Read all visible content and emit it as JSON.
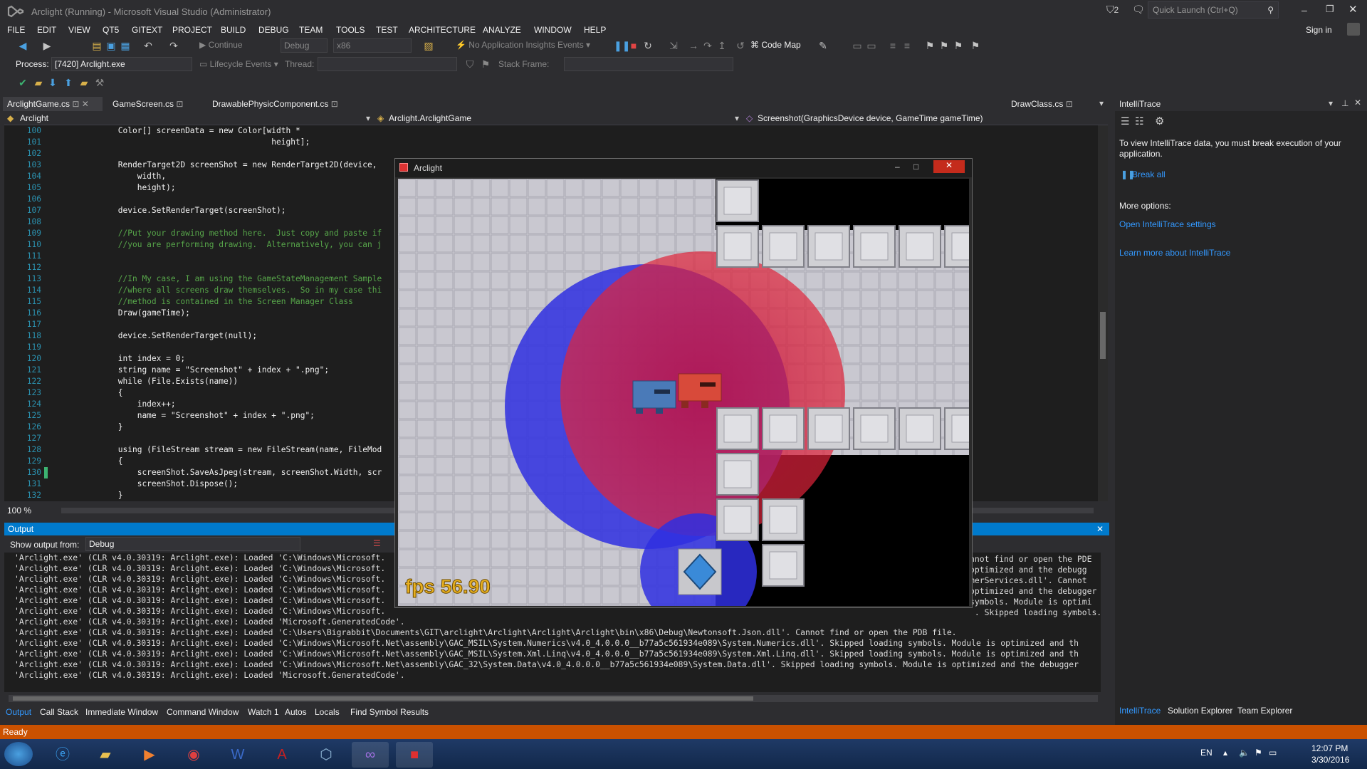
{
  "window": {
    "title": "Arclight (Running) - Microsoft Visual Studio (Administrator)",
    "notif_count": "2",
    "quick_launch": "Quick Launch (Ctrl+Q)",
    "sign_in": "Sign in"
  },
  "menu": [
    "FILE",
    "EDIT",
    "VIEW",
    "QT5",
    "GITEXT",
    "PROJECT",
    "BUILD",
    "DEBUG",
    "TEAM",
    "TOOLS",
    "TEST",
    "ARCHITECTURE",
    "ANALYZE",
    "WINDOW",
    "HELP"
  ],
  "toolbar": {
    "continue": "Continue",
    "config": "Debug",
    "platform": "x86",
    "insights": "No Application Insights Events",
    "codemap": "Code Map",
    "process_label": "Process:",
    "process": "[7420] Arclight.exe",
    "lifecycle": "Lifecycle Events",
    "thread": "Thread:",
    "stackframe": "Stack Frame:"
  },
  "doc_tabs": [
    "ArclightGame.cs",
    "GameScreen.cs",
    "DrawablePhysicComponent.cs",
    "DrawClass.cs"
  ],
  "nav": {
    "project": "Arclight",
    "class": "Arclight.ArclightGame",
    "member": "Screenshot(GraphicsDevice device, GameTime gameTime)"
  },
  "code": [
    {
      "n": "100",
      "t": "            Color[] screenData = new Color[width *"
    },
    {
      "n": "101",
      "t": "                                            height];"
    },
    {
      "n": "102",
      "t": ""
    },
    {
      "n": "103",
      "t": "            RenderTarget2D screenShot = new RenderTarget2D(device,"
    },
    {
      "n": "104",
      "t": "                width,"
    },
    {
      "n": "105",
      "t": "                height);"
    },
    {
      "n": "106",
      "t": ""
    },
    {
      "n": "107",
      "t": "            device.SetRenderTarget(screenShot);"
    },
    {
      "n": "108",
      "t": ""
    },
    {
      "n": "109",
      "t": "            //Put your drawing method here.  Just copy and paste if"
    },
    {
      "n": "110",
      "t": "            //you are performing drawing.  Alternatively, you can j"
    },
    {
      "n": "111",
      "t": ""
    },
    {
      "n": "112",
      "t": ""
    },
    {
      "n": "113",
      "t": "            //In My case, I am using the GameStateManagement Sample"
    },
    {
      "n": "114",
      "t": "            //where all screens draw themselves.  So in my case thi"
    },
    {
      "n": "115",
      "t": "            //method is contained in the Screen Manager Class"
    },
    {
      "n": "116",
      "t": "            Draw(gameTime);"
    },
    {
      "n": "117",
      "t": ""
    },
    {
      "n": "118",
      "t": "            device.SetRenderTarget(null);"
    },
    {
      "n": "119",
      "t": ""
    },
    {
      "n": "120",
      "t": "            int index = 0;"
    },
    {
      "n": "121",
      "t": "            string name = \"Screenshot\" + index + \".png\";"
    },
    {
      "n": "122",
      "t": "            while (File.Exists(name))"
    },
    {
      "n": "123",
      "t": "            {"
    },
    {
      "n": "124",
      "t": "                index++;"
    },
    {
      "n": "125",
      "t": "                name = \"Screenshot\" + index + \".png\";"
    },
    {
      "n": "126",
      "t": "            }"
    },
    {
      "n": "127",
      "t": ""
    },
    {
      "n": "128",
      "t": "            using (FileStream stream = new FileStream(name, FileMod"
    },
    {
      "n": "129",
      "t": "            {"
    },
    {
      "n": "130",
      "t": "                screenShot.SaveAsJpeg(stream, screenShot.Width, scr"
    },
    {
      "n": "131",
      "t": "                screenShot.Dispose();"
    },
    {
      "n": "132",
      "t": "            }"
    }
  ],
  "zoom": "100 %",
  "output": {
    "title": "Output",
    "show_from_label": "Show output from:",
    "show_from": "Debug",
    "lines": [
      "'Arclight.exe' (CLR v4.0.30319: Arclight.exe): Loaded 'C:\\Windows\\Microsoft.",
      "'Arclight.exe' (CLR v4.0.30319: Arclight.exe): Loaded 'C:\\Windows\\Microsoft.",
      "'Arclight.exe' (CLR v4.0.30319: Arclight.exe): Loaded 'C:\\Windows\\Microsoft.",
      "'Arclight.exe' (CLR v4.0.30319: Arclight.exe): Loaded 'C:\\Windows\\Microsoft.",
      "'Arclight.exe' (CLR v4.0.30319: Arclight.exe): Loaded 'C:\\Windows\\Microsoft.",
      "'Arclight.exe' (CLR v4.0.30319: Arclight.exe): Loaded 'C:\\Windows\\Microsoft.",
      "'Arclight.exe' (CLR v4.0.30319: Arclight.exe): Loaded 'Microsoft.GeneratedCode'.",
      "'Arclight.exe' (CLR v4.0.30319: Arclight.exe): Loaded 'C:\\Users\\Bigrabbit\\Documents\\GIT\\arclight\\Arclight\\Arclight\\Arclight\\bin\\x86\\Debug\\Newtonsoft.Json.dll'. Cannot find or open the PDB file.",
      "'Arclight.exe' (CLR v4.0.30319: Arclight.exe): Loaded 'C:\\Windows\\Microsoft.Net\\assembly\\GAC_MSIL\\System.Numerics\\v4.0_4.0.0.0__b77a5c561934e089\\System.Numerics.dll'. Skipped loading symbols. Module is optimized and th",
      "'Arclight.exe' (CLR v4.0.30319: Arclight.exe): Loaded 'C:\\Windows\\Microsoft.Net\\assembly\\GAC_MSIL\\System.Xml.Linq\\v4.0_4.0.0.0__b77a5c561934e089\\System.Xml.Linq.dll'. Skipped loading symbols. Module is optimized and th",
      "'Arclight.exe' (CLR v4.0.30319: Arclight.exe): Loaded 'C:\\Windows\\Microsoft.Net\\assembly\\GAC_32\\System.Data\\v4.0_4.0.0.0__b77a5c561934e089\\System.Data.dll'. Skipped loading symbols. Module is optimized and the debugger",
      "'Arclight.exe' (CLR v4.0.30319: Arclight.exe): Loaded 'Microsoft.GeneratedCode'."
    ],
    "right_fragments": [
      "nnot find or open the PDE",
      "optimized and the debugg",
      "merServices.dll'. Cannot",
      "optimized and the debugger",
      "symbols. Module is optimi",
      " . Skipped loading symbols."
    ]
  },
  "bottom_tabs": [
    "Output",
    "Call Stack",
    "Immediate Window",
    "Command Window",
    "Watch 1",
    "Autos",
    "Locals",
    "Find Symbol Results"
  ],
  "status": "Ready",
  "intellitrace": {
    "title": "IntelliTrace",
    "message": "To view IntelliTrace data, you must break execution of your application.",
    "break_all": "Break all",
    "more": "More options:",
    "settings": "Open IntelliTrace settings",
    "learn": "Learn more about IntelliTrace",
    "tabs": [
      "IntelliTrace",
      "Solution Explorer",
      "Team Explorer"
    ]
  },
  "game": {
    "title": "Arclight",
    "fps": "fps 56.90"
  },
  "tray": {
    "lang": "EN",
    "time": "12:07 PM",
    "date": "3/30/2016"
  },
  "colors": {
    "accent": "#007acc",
    "status": "#ca5100",
    "blue_light": "#2f2fe0",
    "red_light": "#e0243a"
  }
}
